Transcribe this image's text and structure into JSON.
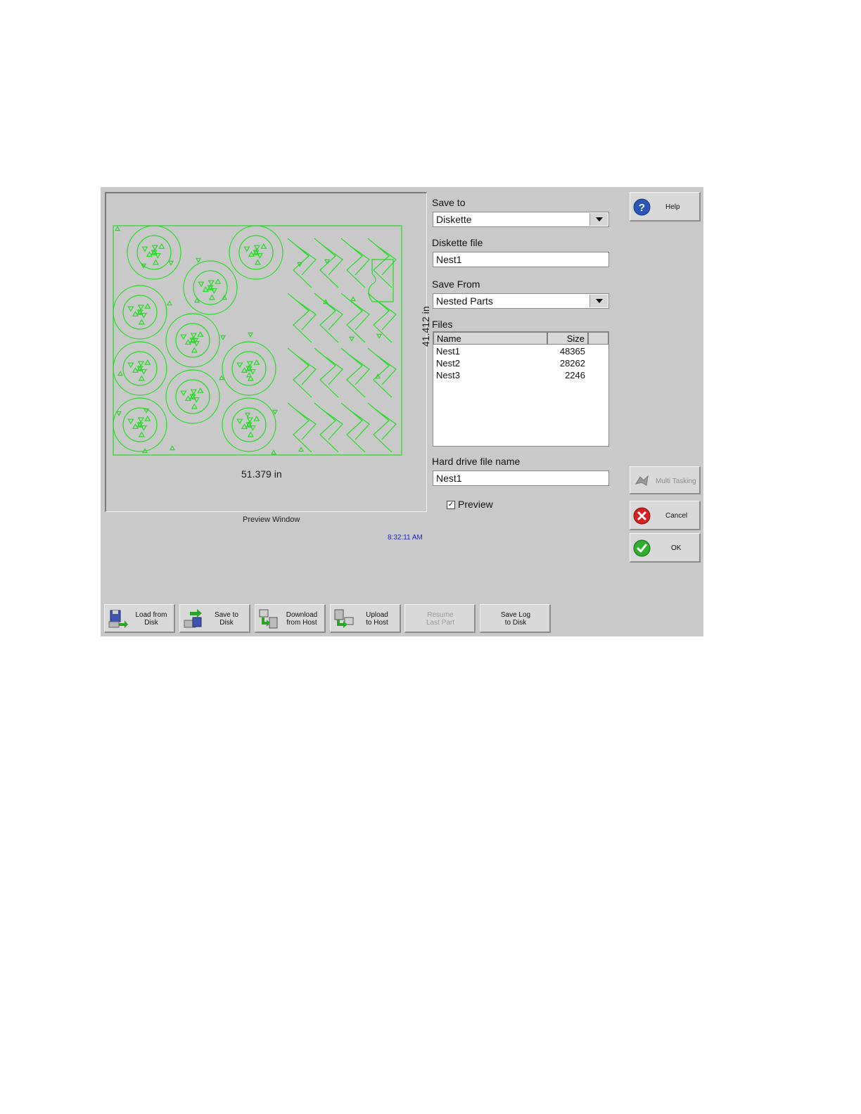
{
  "colors": {
    "panel": "#c9c9c9",
    "nest_line": "#22dd22",
    "clock": "#2222cc"
  },
  "preview": {
    "width_label": "51.379 in",
    "height_label": "41.412 in",
    "caption": "Preview Window",
    "time": "8:32:11 AM"
  },
  "form": {
    "save_to_label": "Save to",
    "save_to_value": "Diskette",
    "diskette_file_label": "Diskette file",
    "diskette_file_value": "Nest1",
    "save_from_label": "Save From",
    "save_from_value": "Nested Parts",
    "files_label": "Files",
    "files_columns": {
      "name": "Name",
      "size": "Size"
    },
    "files": [
      {
        "name": "Nest1",
        "size": "48365"
      },
      {
        "name": "Nest2",
        "size": "28262"
      },
      {
        "name": "Nest3",
        "size": "2246"
      }
    ],
    "hard_drive_label": "Hard drive file name",
    "hard_drive_value": "Nest1",
    "preview_checkbox_label": "Preview",
    "preview_checkbox_mark": "✓"
  },
  "right_buttons": {
    "help": "Help",
    "multitasking": "Multi Tasking",
    "cancel": "Cancel",
    "ok": "OK"
  },
  "toolbar": {
    "load_from_disk": [
      "Load from",
      "Disk"
    ],
    "save_to_disk": [
      "Save to",
      "Disk"
    ],
    "download_from_host": [
      "Download",
      "from Host"
    ],
    "upload_to_host": [
      "Upload",
      "to Host"
    ],
    "resume_last_part": [
      "Resume",
      "Last Part"
    ],
    "save_log_to_disk": [
      "Save Log",
      "to Disk"
    ]
  }
}
